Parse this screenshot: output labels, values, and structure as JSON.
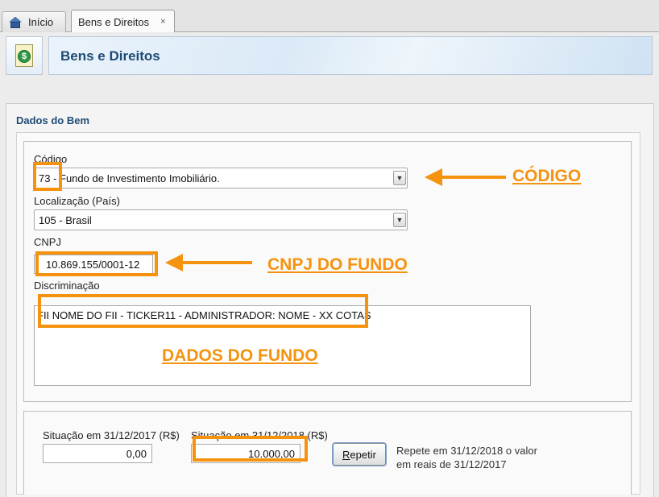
{
  "tabs": [
    {
      "label": "Início"
    },
    {
      "label": "Bens e Direitos",
      "close": "×"
    }
  ],
  "header": {
    "title": "Bens e Direitos",
    "icon": "money-document-icon"
  },
  "section": {
    "title": "Dados do Bem"
  },
  "form": {
    "codigo_label": "Código",
    "codigo_value": "73 - Fundo de Investimento Imobiliário.",
    "localizacao_label": "Localização (País)",
    "localizacao_value": "105 - Brasil",
    "cnpj_label": "CNPJ",
    "cnpj_value": "10.869.155/0001-12",
    "discriminacao_label": "Discriminação",
    "discriminacao_value": "FII NOME DO FII - TICKER11 - ADMINISTRADOR: NOME - XX COTAS"
  },
  "situacao": {
    "label_2017": "Situação em 31/12/2017 (R$)",
    "value_2017": "0,00",
    "label_2018": "Situação em 31/12/2018 (R$)",
    "value_2018": "10.000,00",
    "repetir_first": "R",
    "repetir_rest": "epetir",
    "help_line1": "Repete em 31/12/2018 o valor",
    "help_line2": "em reais de 31/12/2017"
  },
  "annotations": {
    "codigo": "CÓDIGO",
    "cnpj": "CNPJ DO FUNDO",
    "dados": "DADOS DO FUNDO",
    "color": "#f5930f"
  }
}
